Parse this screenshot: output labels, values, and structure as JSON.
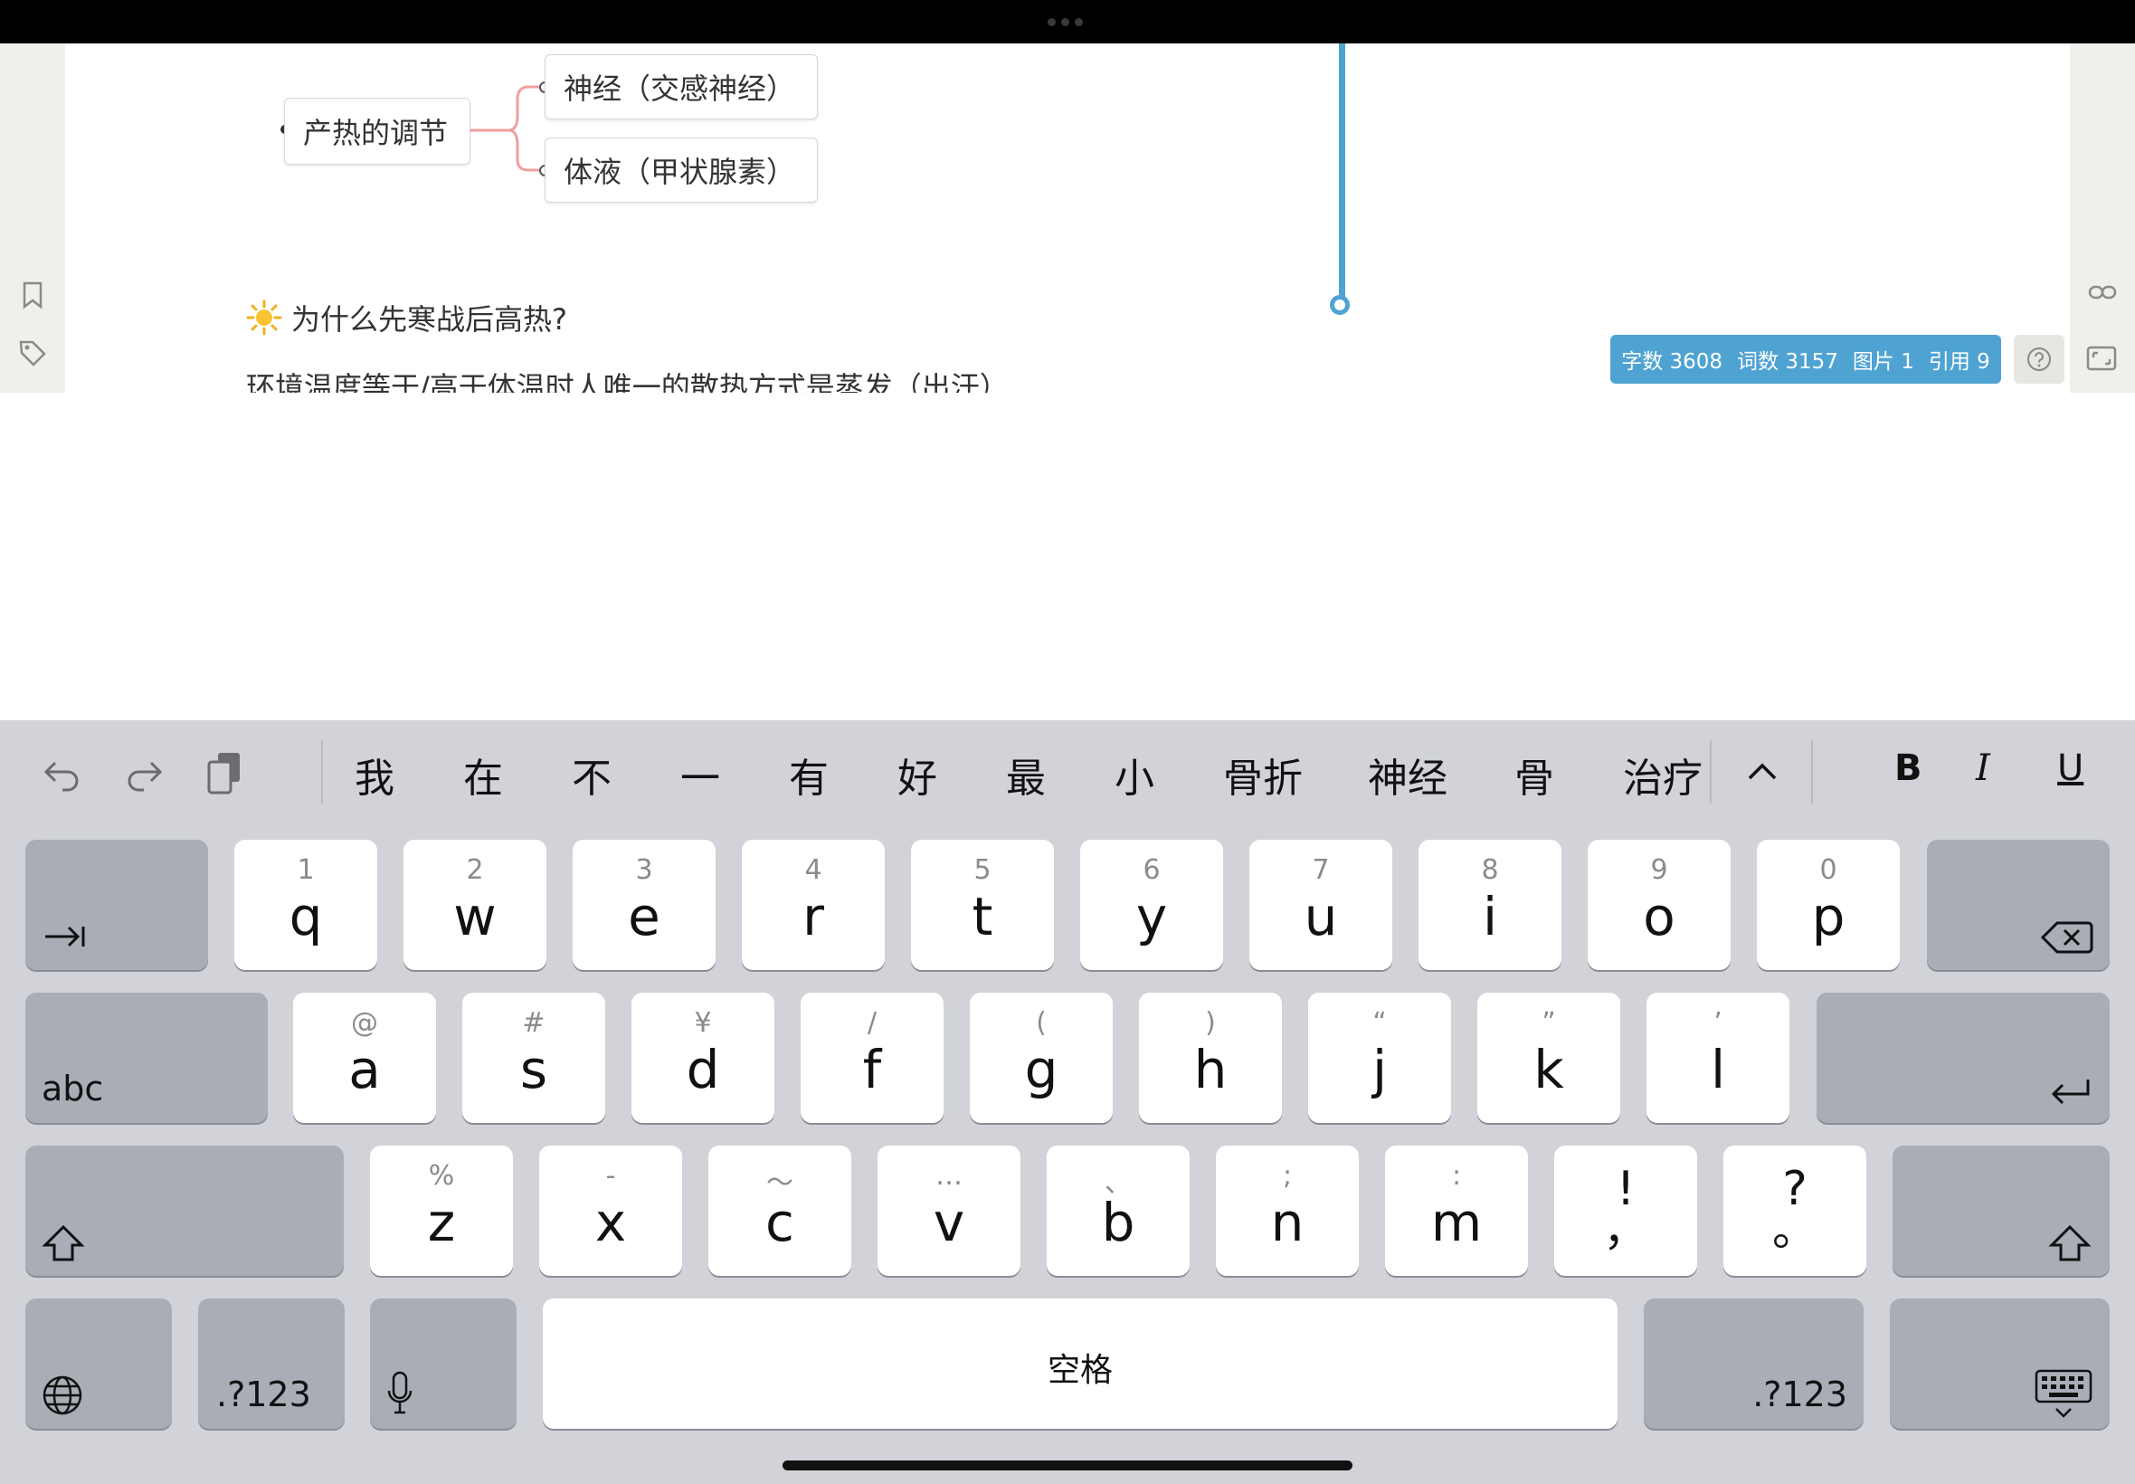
{
  "mindmap": {
    "root": "产热的调节",
    "children": [
      "神经（交感神经）",
      "体液（甲状腺素）"
    ]
  },
  "content": {
    "heading": "为什么先寒战后高热?",
    "paragraph": "环境温度等于/高于体温时人唯一的散热方式是蒸发（出汗）"
  },
  "stats": {
    "chars": "字数 3608",
    "words": "词数 3157",
    "images": "图片 1",
    "refs": "引用 9"
  },
  "candidates": [
    "我",
    "在",
    "不",
    "一",
    "有",
    "好",
    "最",
    "小",
    "骨折",
    "神经",
    "骨",
    "治疗"
  ],
  "format": {
    "bold": "B",
    "italic": "I",
    "underline": "U"
  },
  "keys": {
    "row1": [
      {
        "hint": "1",
        "main": "q"
      },
      {
        "hint": "2",
        "main": "w"
      },
      {
        "hint": "3",
        "main": "e"
      },
      {
        "hint": "4",
        "main": "r"
      },
      {
        "hint": "5",
        "main": "t"
      },
      {
        "hint": "6",
        "main": "y"
      },
      {
        "hint": "7",
        "main": "u"
      },
      {
        "hint": "8",
        "main": "i"
      },
      {
        "hint": "9",
        "main": "o"
      },
      {
        "hint": "0",
        "main": "p"
      }
    ],
    "row2": [
      {
        "hint": "@",
        "main": "a"
      },
      {
        "hint": "#",
        "main": "s"
      },
      {
        "hint": "¥",
        "main": "d"
      },
      {
        "hint": "/",
        "main": "f"
      },
      {
        "hint": "(",
        "main": "g"
      },
      {
        "hint": ")",
        "main": "h"
      },
      {
        "hint": "“",
        "main": "j"
      },
      {
        "hint": "”",
        "main": "k"
      },
      {
        "hint": "’",
        "main": "l"
      }
    ],
    "row3": [
      {
        "hint": "%",
        "main": "z"
      },
      {
        "hint": "-",
        "main": "x"
      },
      {
        "hint": "～",
        "main": "c"
      },
      {
        "hint": "…",
        "main": "v"
      },
      {
        "hint": "、",
        "main": "b"
      },
      {
        "hint": ";",
        "main": "n"
      },
      {
        "hint": ":",
        "main": "m"
      },
      {
        "hint": "!",
        "main": "，"
      },
      {
        "hint": "?",
        "main": "。"
      }
    ],
    "abc": "abc",
    "numbers_left": ".?123",
    "numbers_right": ".?123",
    "space": "空格"
  }
}
